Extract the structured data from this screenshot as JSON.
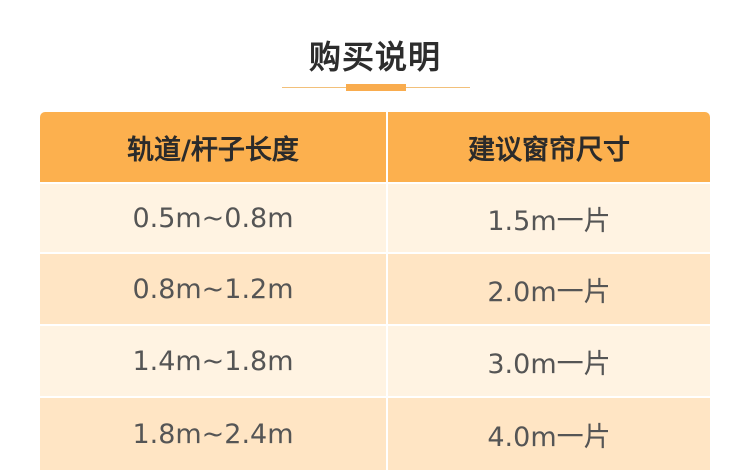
{
  "title": "购买说明",
  "accent_color": "#f9ac4e",
  "table": {
    "headers": [
      "轨道/杆子长度",
      "建议窗帘尺寸"
    ],
    "rows": [
      [
        "0.5m~0.8m",
        "1.5m一片"
      ],
      [
        "0.8m~1.2m",
        "2.0m一片"
      ],
      [
        "1.4m~1.8m",
        "3.0m一片"
      ],
      [
        "1.8m~2.4m",
        "4.0m一片"
      ]
    ]
  }
}
